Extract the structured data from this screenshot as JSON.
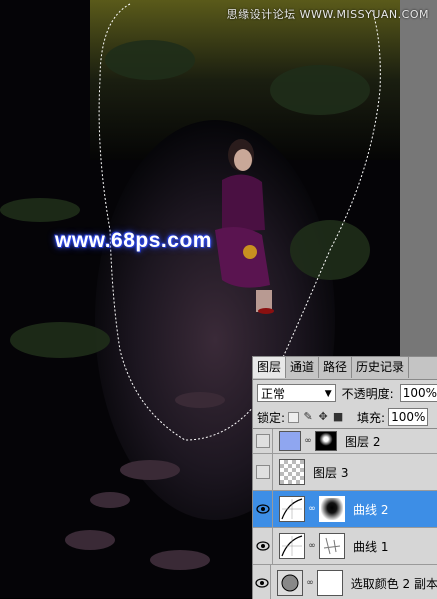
{
  "watermark_top": "思缘设计论坛 WWW.MISSYUAN.COM",
  "watermark_site": "www.68ps.com",
  "layers_panel": {
    "tabs": [
      {
        "label": "图层",
        "active": true
      },
      {
        "label": "通道",
        "active": false
      },
      {
        "label": "路径",
        "active": false
      },
      {
        "label": "历史记录",
        "active": false
      }
    ],
    "blend_mode": "正常",
    "opacity_label": "不透明度:",
    "opacity_value": "100%",
    "lock_label": "锁定:",
    "fill_label": "填充:",
    "fill_value": "100%",
    "layers": [
      {
        "name": "图层 2",
        "visible": false,
        "selected": false,
        "thumb": "solid-blue",
        "mask": "black-with-white-blob"
      },
      {
        "name": "图层 3",
        "visible": false,
        "selected": false,
        "thumb": "transparent",
        "mask": ""
      },
      {
        "name": "曲线 2",
        "visible": true,
        "selected": true,
        "thumb": "curves",
        "mask": "white-with-dark-center"
      },
      {
        "name": "曲线 1",
        "visible": true,
        "selected": false,
        "thumb": "curves",
        "mask": "white-with-gray-strokes"
      },
      {
        "name": "选取颜色 2 副本",
        "visible": true,
        "selected": false,
        "thumb": "selective-color",
        "mask": "white"
      }
    ]
  },
  "colors": {
    "selection_blue": "#3d8ee6",
    "layer2_fill": "#8fa6f0"
  }
}
